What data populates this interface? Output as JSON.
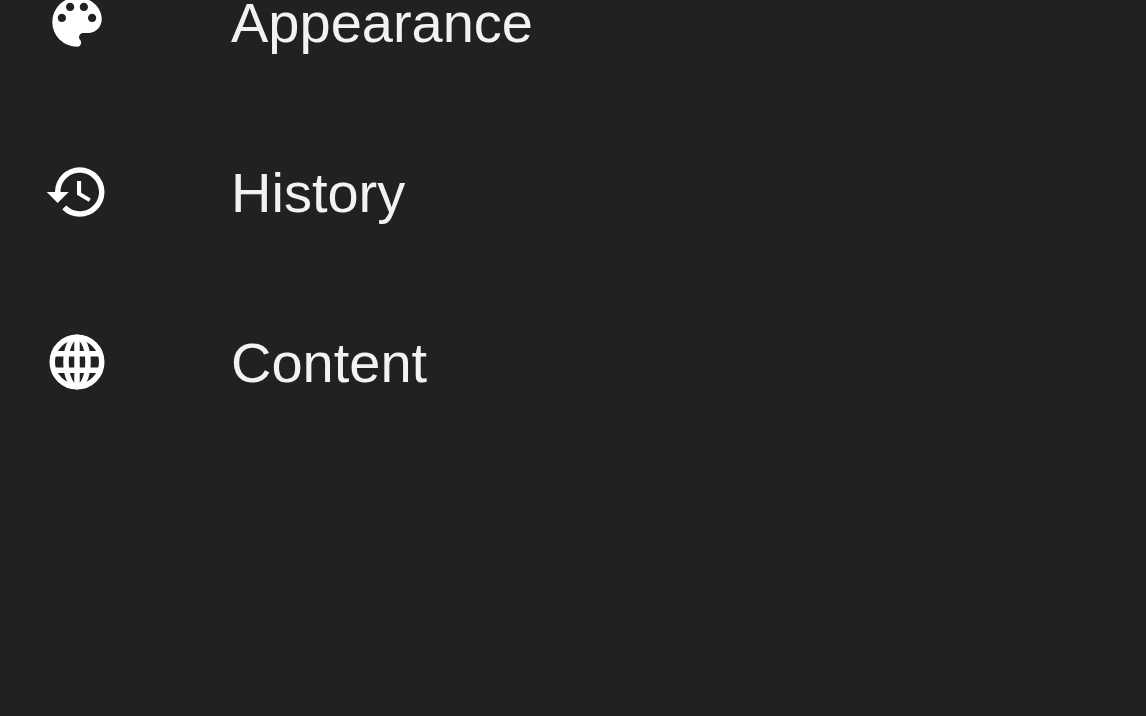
{
  "menu": {
    "items": [
      {
        "label": "Appearance"
      },
      {
        "label": "History"
      },
      {
        "label": "Content"
      }
    ]
  }
}
